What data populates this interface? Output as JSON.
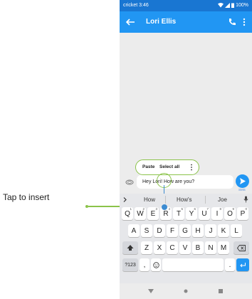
{
  "status_bar": {
    "carrier_time": "cricket 3:46",
    "battery": "100%"
  },
  "app_bar": {
    "title": "Lori Ellis",
    "back_icon": "arrow-left-icon",
    "call_icon": "phone-icon",
    "more_icon": "more-vert-icon"
  },
  "selection_popup": {
    "paste": "Paste",
    "select_all": "Select all"
  },
  "compose": {
    "message": "Hey Lori! How are you?",
    "send_label": "SMS"
  },
  "suggestions": [
    "How",
    "How's",
    "Joe"
  ],
  "keyboard": {
    "row1": [
      {
        "k": "Q",
        "n": "1"
      },
      {
        "k": "W",
        "n": "2"
      },
      {
        "k": "E",
        "n": "3"
      },
      {
        "k": "R",
        "n": "4"
      },
      {
        "k": "T",
        "n": "5"
      },
      {
        "k": "Y",
        "n": "6"
      },
      {
        "k": "U",
        "n": "7"
      },
      {
        "k": "I",
        "n": "8"
      },
      {
        "k": "O",
        "n": "9"
      },
      {
        "k": "P",
        "n": "0"
      }
    ],
    "row2": [
      "A",
      "S",
      "D",
      "F",
      "G",
      "H",
      "J",
      "K",
      "L"
    ],
    "row3": [
      "Z",
      "X",
      "C",
      "V",
      "B",
      "N",
      "M"
    ],
    "symbols_key": "?123",
    "comma_key": ",",
    "period_key": "."
  },
  "callout": {
    "text": "Tap to insert"
  },
  "colors": {
    "app_bar": "#2196f3",
    "status_bar": "#1976d2",
    "highlight": "#8bc34a",
    "handle": "#3c8bd1"
  }
}
